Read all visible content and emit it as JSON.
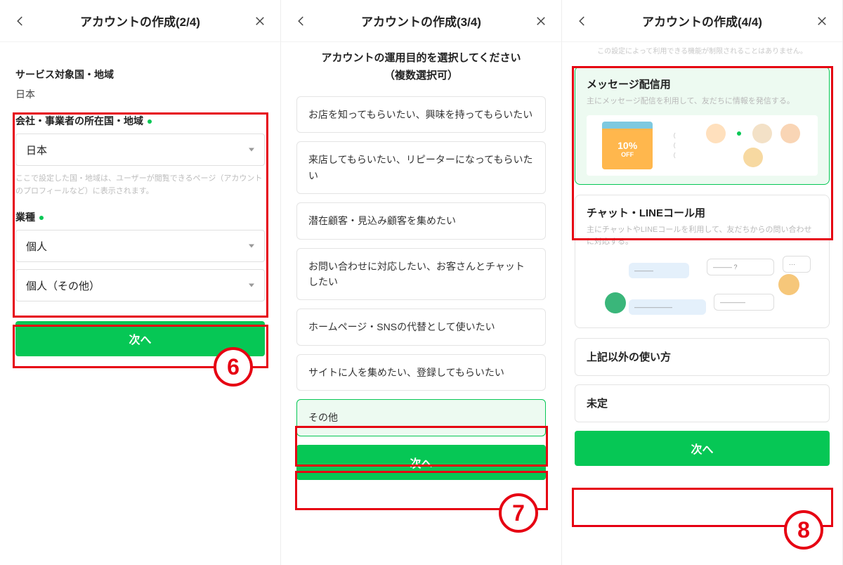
{
  "panels": [
    {
      "header_title": "アカウントの作成(2/4)",
      "service_country_label": "サービス対象国・地域",
      "service_country_value": "日本",
      "company_country_label": "会社・事業者の所在国・地域",
      "company_country_value": "日本",
      "company_country_hint": "ここで設定した国・地域は、ユーザーが閲覧できるページ（アカウントのプロフィールなど）に表示されます。",
      "industry_label": "業種",
      "industry_select1": "個人",
      "industry_select2": "個人（その他）",
      "next_label": "次へ",
      "badge": "6"
    },
    {
      "header_title": "アカウントの作成(3/4)",
      "subhead_line1": "アカウントの運用目的を選択してください",
      "subhead_line2": "（複数選択可）",
      "options": [
        "お店を知ってもらいたい、興味を持ってもらいたい",
        "来店してもらいたい、リピーターになってもらいたい",
        "潜在顧客・見込み顧客を集めたい",
        "お問い合わせに対応したい、お客さんとチャットしたい",
        "ホームページ・SNSの代替として使いたい",
        "サイトに人を集めたい、登録してもらいたい",
        "その他"
      ],
      "selected_index": 6,
      "next_label": "次へ",
      "badge": "7"
    },
    {
      "header_title": "アカウントの作成(4/4)",
      "top_note": "この設定によって利用できる機能が制限されることはありません。",
      "cards": [
        {
          "title": "メッセージ配信用",
          "desc": "主にメッセージ配信を利用して、友だちに情報を発信する。",
          "coupon_label": "10%",
          "coupon_sub": "OFF",
          "selected": true
        },
        {
          "title": "チャット・LINEコール用",
          "desc": "主にチャットやLINEコールを利用して、友だちからの問い合わせに対応する。",
          "selected": false
        }
      ],
      "rows": [
        "上記以外の使い方",
        "未定"
      ],
      "next_label": "次へ",
      "badge": "8"
    }
  ]
}
